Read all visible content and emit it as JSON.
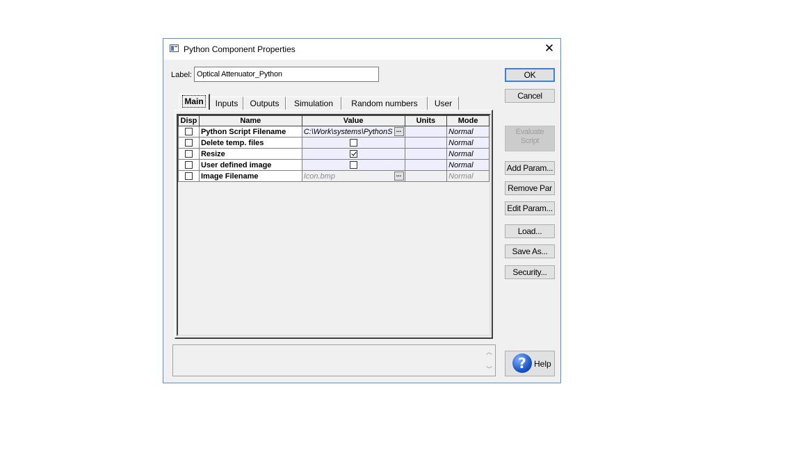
{
  "window": {
    "title": "Python Component Properties",
    "close_glyph": "✕"
  },
  "label_field": {
    "label": "Label:",
    "value": "Optical Attenuator_Python"
  },
  "buttons": {
    "ok": "OK",
    "cancel": "Cancel",
    "evaluate_line1": "Evaluate",
    "evaluate_line2": "Script",
    "add_param": "Add Param...",
    "remove_par": "Remove Par",
    "edit_param": "Edit Param...",
    "load": "Load...",
    "save_as": "Save As...",
    "security": "Security...",
    "help": "Help"
  },
  "tabs": [
    {
      "label": "Main",
      "active": true
    },
    {
      "label": "Inputs"
    },
    {
      "label": "Outputs"
    },
    {
      "label": "Simulation"
    },
    {
      "label": "Random numbers"
    },
    {
      "label": "User"
    }
  ],
  "table": {
    "headers": [
      "Disp",
      "Name",
      "Value",
      "Units",
      "Mode"
    ],
    "rows": [
      {
        "name": "Python Script Filename",
        "value": "C:\\Work\\systems\\PythonS",
        "units": "",
        "mode": "Normal"
      },
      {
        "name": "Delete temp. files",
        "value": "",
        "units": "",
        "mode": "Normal"
      },
      {
        "name": "Resize",
        "value": "",
        "units": "",
        "mode": "Normal"
      },
      {
        "name": "User defined image",
        "value": "",
        "units": "",
        "mode": "Normal"
      },
      {
        "name": "Image Filename",
        "value": "Icon.bmp",
        "units": "",
        "mode": "Normal"
      }
    ],
    "ellipsis": "..."
  },
  "colors": {
    "accent": "#3c7fd4",
    "window_border": "#5a8fc8",
    "value_cell": "#eeeefc"
  },
  "icons": {
    "app": "component-window-icon",
    "help": "question-mark-icon"
  }
}
